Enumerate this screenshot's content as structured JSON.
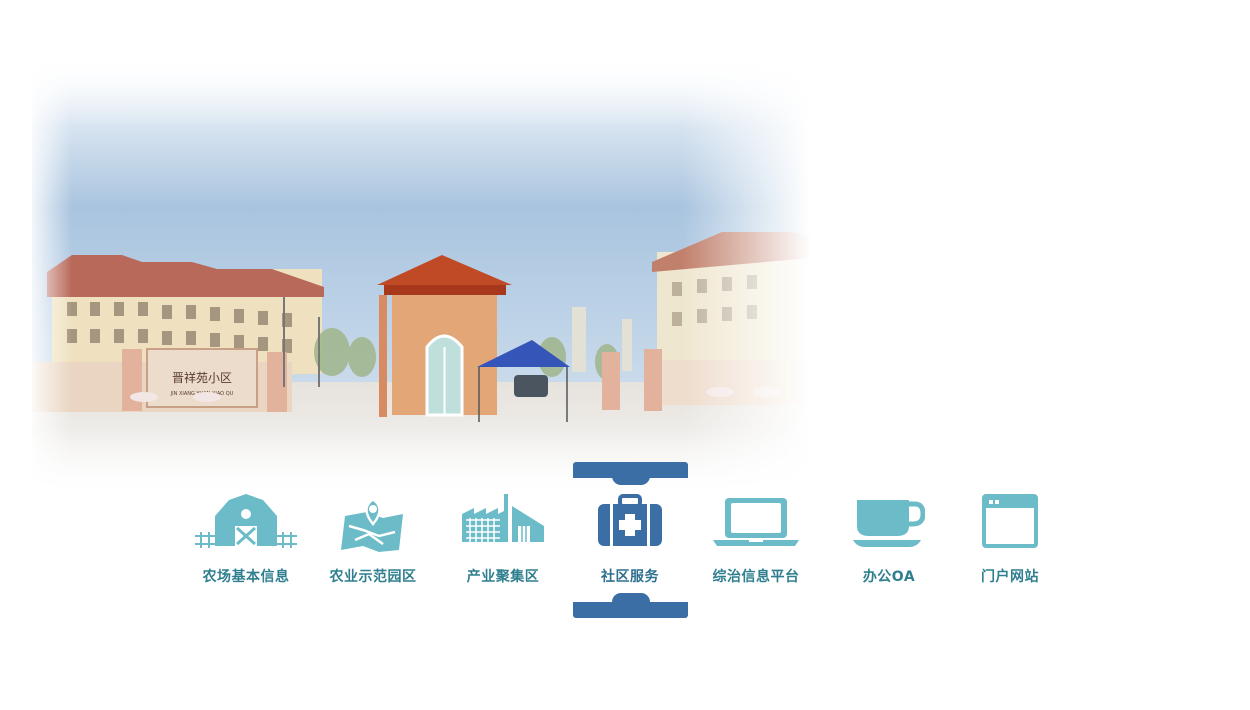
{
  "banner": {
    "sign_text": "晋祥苑小区",
    "sign_pinyin": "JIN XIANG YUAN XIAO QU"
  },
  "nav": {
    "items": [
      {
        "label": "农场基本信息",
        "icon": "barn-icon"
      },
      {
        "label": "农业示范园区",
        "icon": "map-pin-icon"
      },
      {
        "label": "产业聚集区",
        "icon": "factory-icon"
      },
      {
        "label": "社区服务",
        "icon": "medical-kit-icon",
        "active": true
      },
      {
        "label": "综治信息平台",
        "icon": "laptop-icon"
      },
      {
        "label": "办公OA",
        "icon": "coffee-cup-icon"
      },
      {
        "label": "门户网站",
        "icon": "browser-window-icon"
      }
    ]
  },
  "colors": {
    "icon": "#6bbcc8",
    "active_icon": "#3b6ea5",
    "label": "#2f7f8f",
    "active_highlight": "#3b6ea5"
  }
}
